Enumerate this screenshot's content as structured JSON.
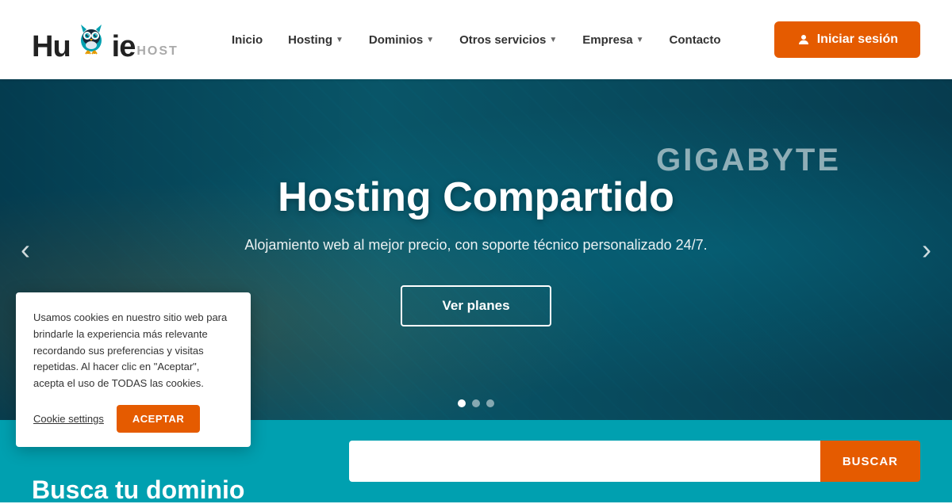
{
  "logo": {
    "text_start": "Hu",
    "text_owl": "",
    "text_end": "ie",
    "host_label": "HOST"
  },
  "nav": {
    "inicio": "Inicio",
    "hosting": "Hosting",
    "dominios": "Dominios",
    "otros_servicios": "Otros servicios",
    "empresa": "Empresa",
    "contacto": "Contacto"
  },
  "login_button": "Iniciar sesión",
  "hero": {
    "title": "Hosting Compartido",
    "subtitle": "Alojamiento web al mejor precio, con soporte técnico personalizado 24/7.",
    "cta_label": "Ver planes",
    "bg_text": "GIGABYTE"
  },
  "carousel": {
    "prev_label": "‹",
    "next_label": "›",
    "dots": [
      {
        "active": true
      },
      {
        "active": false
      },
      {
        "active": false
      }
    ]
  },
  "cookie_banner": {
    "text": "Usamos cookies en nuestro sitio web para brindarle la experiencia más relevante recordando sus preferencias y visitas repetidas. Al hacer clic en \"Aceptar\", acepta el uso de TODAS las cookies.",
    "settings_label": "Cookie settings",
    "accept_label": "ACEPTAR"
  },
  "domain_search": {
    "label": "Busca tu dominio",
    "placeholder": "",
    "button_label": "BUSCAR"
  },
  "colors": {
    "orange": "#e55b00",
    "teal": "#00a0b0",
    "dark": "#1a3a4a"
  }
}
